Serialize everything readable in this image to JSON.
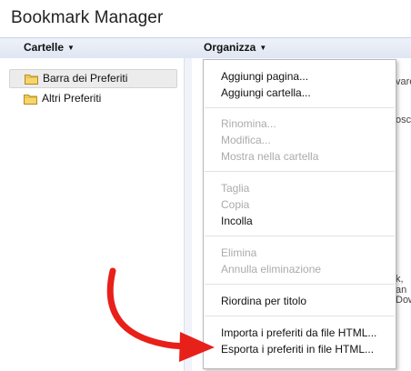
{
  "app": {
    "title": "Bookmark Manager"
  },
  "toolbar": {
    "folders_label": "Cartelle",
    "organize_label": "Organizza"
  },
  "folders": [
    {
      "label": "Barra dei Preferiti",
      "selected": true
    },
    {
      "label": "Altri Preferiti",
      "selected": false
    }
  ],
  "menu": {
    "add_page": "Aggiungi pagina...",
    "add_folder": "Aggiungi cartella...",
    "rename": "Rinomina...",
    "edit": "Modifica...",
    "show_in_folder": "Mostra nella cartella",
    "cut": "Taglia",
    "copy": "Copia",
    "paste": "Incolla",
    "delete": "Elimina",
    "undo_delete": "Annulla eliminazione",
    "sort_by_title": "Riordina per titolo",
    "import_html": "Importa i preferiti da file HTML...",
    "export_html": "Esporta i preferiti in file HTML..."
  },
  "peek_text": {
    "line1": "vare",
    "line2": "osca",
    "line3": "k, an",
    "line4": "Dow"
  },
  "colors": {
    "arrow": "#e8201a",
    "toolbar_bg": "#e4eaf5"
  }
}
